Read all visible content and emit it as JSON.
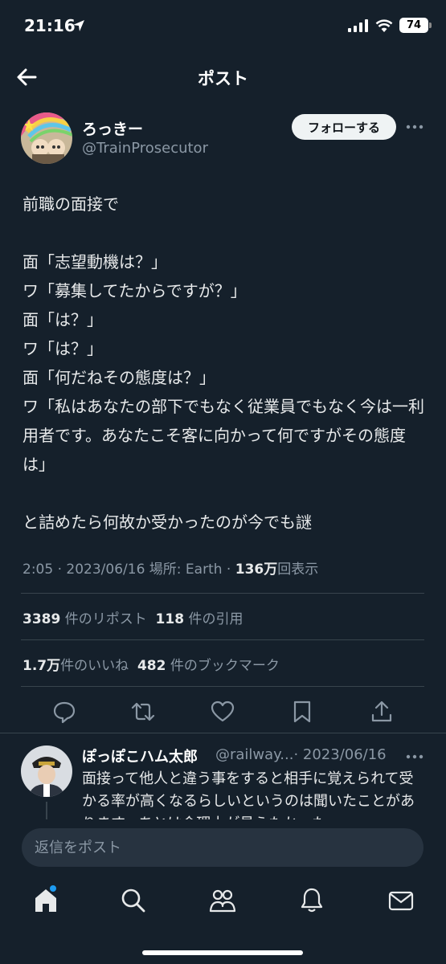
{
  "status_bar": {
    "time": "21:16",
    "battery": "74"
  },
  "header": {
    "title": "ポスト"
  },
  "author": {
    "display_name": "ろっきー",
    "handle": "@TrainProsecutor",
    "follow_label": "フォローする"
  },
  "post": {
    "text": "前職の面接で\n\n面「志望動機は？」\nワ「募集してたからですが？」\n面「は？」\nワ「は？」\n面「何だねその態度は？」\nワ「私はあなたの部下でもなく従業員でもなく今は一利用者です。あなたこそ客に向かって何ですがその態度は」\n\nと詰めたら何故か受かったのが今でも謎"
  },
  "meta": {
    "time": "2:05",
    "date": "2023/06/16",
    "location_label": "場所: Earth",
    "views_count": "136万",
    "views_label": "回表示"
  },
  "stats": {
    "reposts_count": "3389",
    "reposts_label": "件のリポスト",
    "quotes_count": "118",
    "quotes_label": "件の引用",
    "likes_count": "1.7万",
    "likes_label": "件のいいね",
    "bookmarks_count": "482",
    "bookmarks_label": "件のブックマーク"
  },
  "actions": [
    "reply-icon",
    "repost-icon",
    "like-icon",
    "bookmark-icon",
    "share-icon"
  ],
  "reply": {
    "name": "ぽっぽこハム太郎",
    "handle": "@railway...",
    "date": "· 2023/06/16",
    "text": "面接って他人と違う事をすると相手に覚えられて受かる率が高くなるらしいというのは聞いたことがあります。あとは会理士が見えたかった"
  },
  "compose": {
    "placeholder": "返信をポスト"
  },
  "tabs": [
    "home-icon",
    "search-icon",
    "communities-icon",
    "notifications-icon",
    "messages-icon"
  ],
  "colors": {
    "background": "#15202b",
    "accent": "#1d9bf0",
    "secondary_text": "#8b98a5",
    "divider": "#38444d"
  }
}
